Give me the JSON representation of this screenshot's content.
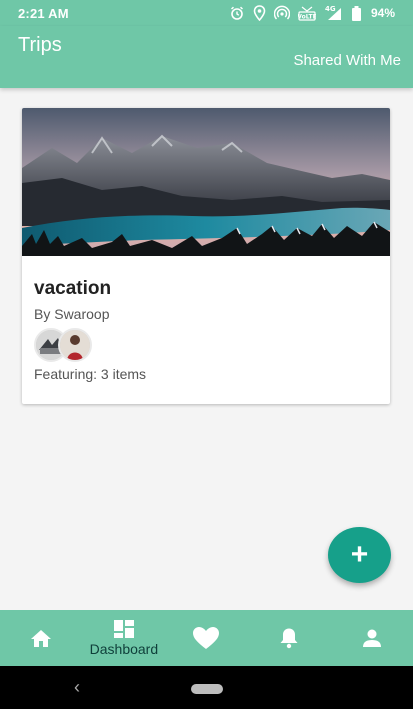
{
  "status_bar": {
    "time": "2:21 AM",
    "network": "4G",
    "battery": "94%",
    "icons": [
      "alarm-icon",
      "location-icon",
      "hotspot-icon",
      "volte-icon",
      "signal-icon",
      "battery-icon"
    ]
  },
  "app_bar": {
    "title": "Trips",
    "shared_link": "Shared With Me"
  },
  "trip": {
    "name": "vacation",
    "owner": "By Swaroop",
    "featuring": "Featuring: 3 items",
    "image": "mountain-lake-photo"
  },
  "fab": {
    "label": "+"
  },
  "bottom_nav": {
    "items": [
      {
        "icon": "home-icon",
        "label": ""
      },
      {
        "icon": "dashboard-icon",
        "label": "Dashboard"
      },
      {
        "icon": "heart-icon",
        "label": ""
      },
      {
        "icon": "bell-icon",
        "label": ""
      },
      {
        "icon": "person-icon",
        "label": ""
      }
    ],
    "active_index": 1
  },
  "system_nav": {
    "back": "‹"
  },
  "colors": {
    "primary": "#6fc7a7",
    "fab": "#16a08a",
    "nav_label": "#0f3f3a"
  }
}
